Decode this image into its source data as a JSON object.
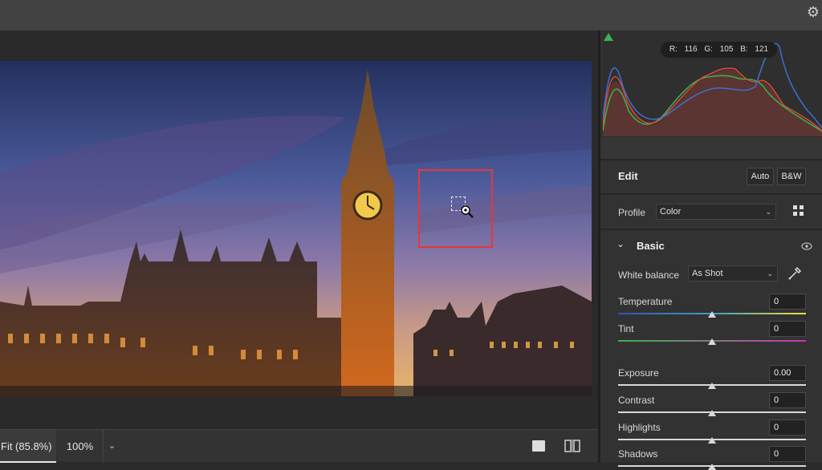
{
  "toolbar": {
    "settings_icon": "gear-icon"
  },
  "histogram": {
    "readout": "R: 116  G: 105  B: 121",
    "colors": {
      "red": "#e04a3a",
      "green": "#3fb24d",
      "blue": "#3f6fd6"
    }
  },
  "canvas": {
    "fit_label": "Fit (85.8%)",
    "zoom_label": "100%",
    "zoom_dropdown_icon": "chevron-down-icon",
    "selection_color": "#e5373a"
  },
  "edit": {
    "title": "Edit",
    "auto_label": "Auto",
    "bw_label": "B&W",
    "profile_label": "Profile",
    "profile_value": "Color",
    "basic_title": "Basic",
    "white_balance_label": "White balance",
    "white_balance_value": "As Shot",
    "sliders": [
      {
        "label": "Temperature",
        "value": "0",
        "level": 0.5
      },
      {
        "label": "Tint",
        "value": "0",
        "level": 0.5
      },
      {
        "label": "Exposure",
        "value": "0.00",
        "level": 0.5
      },
      {
        "label": "Contrast",
        "value": "0",
        "level": 0.5
      },
      {
        "label": "Highlights",
        "value": "0",
        "level": 0.5
      },
      {
        "label": "Shadows",
        "value": "0",
        "level": 0.5
      }
    ]
  }
}
